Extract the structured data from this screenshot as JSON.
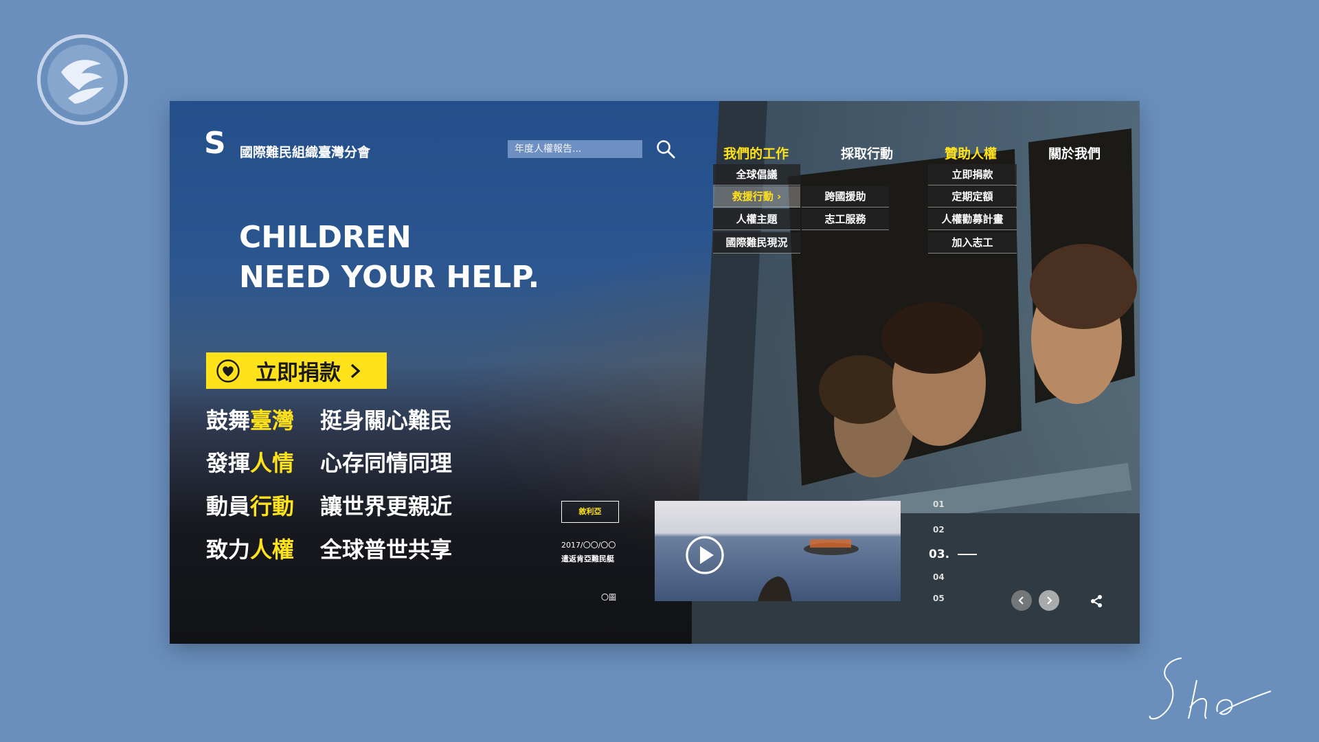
{
  "brand": {
    "mark": "S",
    "name": "國際難民組織臺灣分會"
  },
  "search": {
    "placeholder": "年度人權報告..."
  },
  "nav": [
    {
      "label": "我們的工作",
      "active": true
    },
    {
      "label": "採取行動",
      "active": false
    },
    {
      "label": "贊助人權",
      "active": true
    },
    {
      "label": "關於我們",
      "active": false
    }
  ],
  "work_menu": [
    "全球倡議",
    "救援行動 ›",
    "人權主題",
    "國際難民現況"
  ],
  "rescue_submenu": [
    "跨國援助",
    "志工服務"
  ],
  "sponsor_menu": [
    "立即捐款",
    "定期定額",
    "人權勸募計畫",
    "加入志工"
  ],
  "headline": {
    "line1": "CHILDREN",
    "line2": "NEED YOUR HELP."
  },
  "donate": {
    "label": "立即捐款"
  },
  "slogans": [
    {
      "left_a": "鼓舞",
      "left_b": "臺灣",
      "right": "挺身關心難民"
    },
    {
      "left_a": "發揮",
      "left_b": "人情",
      "right": "心存同情同理"
    },
    {
      "left_a": "動員",
      "left_b": "行動",
      "right": "讓世界更親近"
    },
    {
      "left_a": "致力",
      "left_b": "人權",
      "right": "全球普世共享"
    }
  ],
  "feature": {
    "tag": "敘利亞",
    "date": "2017/〇〇/〇〇",
    "caption": "遣返肯亞難民艇",
    "photo_label": "〇圖"
  },
  "pager": {
    "items": [
      "01",
      "02",
      "03.",
      "04",
      "05"
    ],
    "current_index": 2
  },
  "colors": {
    "background": "#6a8fbd",
    "accent": "#ffe21a",
    "search_bg": "#6e8fc2"
  },
  "icons": [
    "search-icon",
    "heart-icon",
    "chevron-right-icon",
    "play-icon",
    "arrow-left-icon",
    "arrow-right-icon",
    "share-icon"
  ]
}
